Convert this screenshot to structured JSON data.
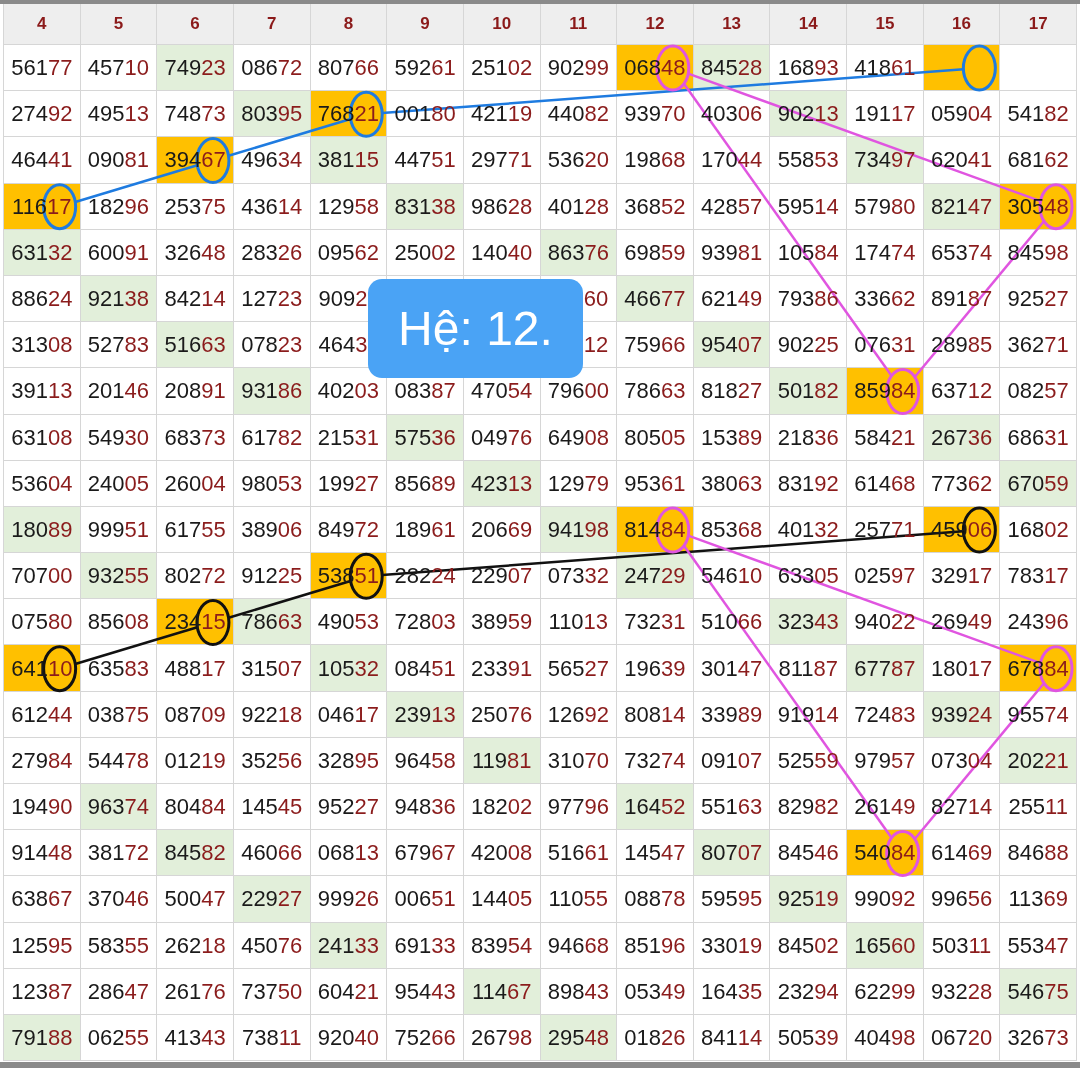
{
  "columns": [
    "4",
    "5",
    "6",
    "7",
    "8",
    "9",
    "10",
    "11",
    "12",
    "13",
    "14",
    "15",
    "16",
    "17"
  ],
  "rows": [
    {
      "cells": [
        {
          "text": "56177"
        },
        {
          "text": "45710"
        },
        {
          "text": "74923",
          "color": "#e2efda"
        },
        {
          "text": "08672"
        },
        {
          "text": "80766"
        },
        {
          "text": "59261"
        },
        {
          "text": "25102"
        },
        {
          "text": "90299"
        },
        {
          "text": "06848",
          "color": "#ffc000"
        },
        {
          "text": "84528",
          "color": "#e2efda"
        },
        {
          "text": "16893"
        },
        {
          "text": "41861"
        },
        {
          "color": "#ffc000"
        },
        {
          "kind": "empty"
        }
      ]
    },
    {
      "cells": [
        {
          "text": "27492"
        },
        {
          "text": "49513"
        },
        {
          "text": "74873"
        },
        {
          "text": "80395",
          "color": "#e2efda"
        },
        {
          "text": "76821",
          "color": "#ffc000"
        },
        {
          "text": "00180"
        },
        {
          "text": "42119"
        },
        {
          "text": "44082"
        },
        {
          "text": "93970"
        },
        {
          "text": "40306"
        },
        {
          "text": "90213",
          "color": "#e2efda"
        },
        {
          "text": "19117"
        },
        {
          "text": "05904"
        },
        {
          "text": "54182"
        }
      ]
    },
    {
      "cells": [
        {
          "text": "46441"
        },
        {
          "text": "09081"
        },
        {
          "text": "39467",
          "color": "#ffc000"
        },
        {
          "text": "49634"
        },
        {
          "text": "38115",
          "color": "#e2efda"
        },
        {
          "text": "44751"
        },
        {
          "text": "29771"
        },
        {
          "text": "53620"
        },
        {
          "text": "19868"
        },
        {
          "text": "17044"
        },
        {
          "text": "55853"
        },
        {
          "text": "73497",
          "color": "#e2efda"
        },
        {
          "text": "62041"
        },
        {
          "text": "68162"
        }
      ]
    },
    {
      "cells": [
        {
          "text": "11617",
          "color": "#ffc000"
        },
        {
          "text": "18296"
        },
        {
          "text": "25375"
        },
        {
          "text": "43614"
        },
        {
          "text": "12958"
        },
        {
          "text": "83138",
          "color": "#e2efda"
        },
        {
          "text": "98628"
        },
        {
          "text": "40128"
        },
        {
          "text": "36852"
        },
        {
          "text": "42857"
        },
        {
          "text": "59514"
        },
        {
          "text": "57980"
        },
        {
          "text": "82147",
          "color": "#e2efda"
        },
        {
          "text": "30548",
          "color": "#ffc000"
        }
      ]
    },
    {
      "cells": [
        {
          "text": "63132",
          "color": "#e2efda"
        },
        {
          "text": "60091"
        },
        {
          "text": "32648"
        },
        {
          "text": "28326"
        },
        {
          "text": "09562"
        },
        {
          "text": "25002"
        },
        {
          "text": "14040"
        },
        {
          "text": "86376",
          "color": "#e2efda"
        },
        {
          "text": "69859"
        },
        {
          "text": "93981"
        },
        {
          "text": "10584"
        },
        {
          "text": "17474"
        },
        {
          "text": "65374"
        },
        {
          "text": "84598"
        }
      ]
    },
    {
      "cells": [
        {
          "text": "88624"
        },
        {
          "text": "92138",
          "color": "#e2efda"
        },
        {
          "text": "84214"
        },
        {
          "text": "12723"
        },
        {
          "text": "9092",
          "kind": "covered-end"
        },
        {},
        {},
        {
          "text": "60",
          "kind": "covered-start"
        },
        {
          "text": "46677",
          "color": "#e2efda"
        },
        {
          "text": "62149"
        },
        {
          "text": "79386"
        },
        {
          "text": "33662"
        },
        {
          "text": "89187"
        },
        {
          "text": "92527"
        }
      ]
    },
    {
      "cells": [
        {
          "text": "31308"
        },
        {
          "text": "52783"
        },
        {
          "text": "51663",
          "color": "#e2efda"
        },
        {
          "text": "07823"
        },
        {
          "text": "4643",
          "kind": "covered-end"
        },
        {},
        {},
        {
          "text": "12",
          "kind": "covered-start"
        },
        {
          "text": "75966"
        },
        {
          "text": "95407",
          "color": "#e2efda"
        },
        {
          "text": "90225"
        },
        {
          "text": "07631"
        },
        {
          "text": "28985"
        },
        {
          "text": "36271"
        }
      ]
    },
    {
      "cells": [
        {
          "text": "39113"
        },
        {
          "text": "20146"
        },
        {
          "text": "20891"
        },
        {
          "text": "93186",
          "color": "#e2efda"
        },
        {
          "text": "40203"
        },
        {
          "text": "08387"
        },
        {
          "text": "47054"
        },
        {
          "text": "79600"
        },
        {
          "text": "78663"
        },
        {
          "text": "81827"
        },
        {
          "text": "50182",
          "color": "#e2efda"
        },
        {
          "text": "85984",
          "color": "#ffc000"
        },
        {
          "text": "63712"
        },
        {
          "text": "08257"
        }
      ]
    },
    {
      "cells": [
        {
          "text": "63108"
        },
        {
          "text": "54930"
        },
        {
          "text": "68373"
        },
        {
          "text": "61782"
        },
        {
          "text": "21531"
        },
        {
          "text": "57536",
          "color": "#e2efda"
        },
        {
          "text": "04976"
        },
        {
          "text": "64908"
        },
        {
          "text": "80505"
        },
        {
          "text": "15389"
        },
        {
          "text": "21836"
        },
        {
          "text": "58421"
        },
        {
          "text": "26736",
          "color": "#e2efda"
        },
        {
          "text": "68631"
        }
      ]
    },
    {
      "cells": [
        {
          "text": "53604"
        },
        {
          "text": "24005"
        },
        {
          "text": "26004"
        },
        {
          "text": "98053"
        },
        {
          "text": "19927"
        },
        {
          "text": "85689"
        },
        {
          "text": "42313",
          "color": "#e2efda"
        },
        {
          "text": "12979"
        },
        {
          "text": "95361"
        },
        {
          "text": "38063"
        },
        {
          "text": "83192"
        },
        {
          "text": "61468"
        },
        {
          "text": "77362"
        },
        {
          "text": "67059",
          "color": "#e2efda"
        }
      ]
    },
    {
      "cells": [
        {
          "text": "18089",
          "color": "#e2efda"
        },
        {
          "text": "99951"
        },
        {
          "text": "61755"
        },
        {
          "text": "38906"
        },
        {
          "text": "84972"
        },
        {
          "text": "18961"
        },
        {
          "text": "20669"
        },
        {
          "text": "94198",
          "color": "#e2efda"
        },
        {
          "text": "81484",
          "color": "#ffc000"
        },
        {
          "text": "85368"
        },
        {
          "text": "40132"
        },
        {
          "text": "25771"
        },
        {
          "text": "45906",
          "color": "#ffc000"
        },
        {
          "text": "16802"
        }
      ]
    },
    {
      "cells": [
        {
          "text": "70700"
        },
        {
          "text": "93255",
          "color": "#e2efda"
        },
        {
          "text": "80272"
        },
        {
          "text": "91225"
        },
        {
          "text": "53851",
          "color": "#ffc000"
        },
        {
          "text": "28224"
        },
        {
          "text": "22907"
        },
        {
          "text": "07332"
        },
        {
          "text": "24729",
          "color": "#e2efda"
        },
        {
          "text": "54610"
        },
        {
          "text": "63305"
        },
        {
          "text": "02597"
        },
        {
          "text": "32917"
        },
        {
          "text": "78317"
        }
      ]
    },
    {
      "cells": [
        {
          "text": "07580"
        },
        {
          "text": "85608"
        },
        {
          "text": "23415",
          "color": "#ffc000"
        },
        {
          "text": "78663",
          "color": "#e2efda"
        },
        {
          "text": "49053"
        },
        {
          "text": "72803"
        },
        {
          "text": "38959"
        },
        {
          "text": "11013"
        },
        {
          "text": "73231"
        },
        {
          "text": "51066"
        },
        {
          "text": "32343",
          "color": "#e2efda"
        },
        {
          "text": "94022"
        },
        {
          "text": "26949"
        },
        {
          "text": "24396"
        }
      ]
    },
    {
      "cells": [
        {
          "text": "64110",
          "color": "#ffc000"
        },
        {
          "text": "63583"
        },
        {
          "text": "48817"
        },
        {
          "text": "31507"
        },
        {
          "text": "10532",
          "color": "#e2efda"
        },
        {
          "text": "08451"
        },
        {
          "text": "23391"
        },
        {
          "text": "56527"
        },
        {
          "text": "19639"
        },
        {
          "text": "30147"
        },
        {
          "text": "81187"
        },
        {
          "text": "67787",
          "color": "#e2efda"
        },
        {
          "text": "18017"
        },
        {
          "text": "67884",
          "color": "#ffc000"
        }
      ]
    },
    {
      "cells": [
        {
          "text": "61244"
        },
        {
          "text": "03875"
        },
        {
          "text": "08709"
        },
        {
          "text": "92218"
        },
        {
          "text": "04617"
        },
        {
          "text": "23913",
          "color": "#e2efda"
        },
        {
          "text": "25076"
        },
        {
          "text": "12692"
        },
        {
          "text": "80814"
        },
        {
          "text": "33989"
        },
        {
          "text": "91914"
        },
        {
          "text": "72483"
        },
        {
          "text": "93924",
          "color": "#e2efda"
        },
        {
          "text": "95574"
        }
      ]
    },
    {
      "cells": [
        {
          "text": "27984"
        },
        {
          "text": "54478"
        },
        {
          "text": "01219"
        },
        {
          "text": "35256"
        },
        {
          "text": "32895"
        },
        {
          "text": "96458"
        },
        {
          "text": "11981",
          "color": "#e2efda"
        },
        {
          "text": "31070"
        },
        {
          "text": "73274"
        },
        {
          "text": "09107"
        },
        {
          "text": "52559"
        },
        {
          "text": "97957"
        },
        {
          "text": "07304"
        },
        {
          "text": "20221",
          "color": "#e2efda"
        }
      ]
    },
    {
      "cells": [
        {
          "text": "19490"
        },
        {
          "text": "96374",
          "color": "#e2efda"
        },
        {
          "text": "80484"
        },
        {
          "text": "14545"
        },
        {
          "text": "95227"
        },
        {
          "text": "94836"
        },
        {
          "text": "18202"
        },
        {
          "text": "97796"
        },
        {
          "text": "16452",
          "color": "#e2efda"
        },
        {
          "text": "55163"
        },
        {
          "text": "82982"
        },
        {
          "text": "26149"
        },
        {
          "text": "82714"
        },
        {
          "text": "25511"
        }
      ]
    },
    {
      "cells": [
        {
          "text": "91448"
        },
        {
          "text": "38172"
        },
        {
          "text": "84582",
          "color": "#e2efda"
        },
        {
          "text": "46066"
        },
        {
          "text": "06813"
        },
        {
          "text": "67967"
        },
        {
          "text": "42008"
        },
        {
          "text": "51661"
        },
        {
          "text": "14547"
        },
        {
          "text": "80707",
          "color": "#e2efda"
        },
        {
          "text": "84546"
        },
        {
          "text": "54084",
          "color": "#ffc000"
        },
        {
          "text": "61469"
        },
        {
          "text": "84688"
        }
      ]
    },
    {
      "cells": [
        {
          "text": "63867"
        },
        {
          "text": "37046"
        },
        {
          "text": "50047"
        },
        {
          "text": "22927",
          "color": "#e2efda"
        },
        {
          "text": "99926"
        },
        {
          "text": "00651"
        },
        {
          "text": "14405"
        },
        {
          "text": "11055"
        },
        {
          "text": "08878"
        },
        {
          "text": "59595"
        },
        {
          "text": "92519",
          "color": "#e2efda"
        },
        {
          "text": "99092"
        },
        {
          "text": "99656"
        },
        {
          "text": "11369"
        }
      ]
    },
    {
      "cells": [
        {
          "text": "12595"
        },
        {
          "text": "58355"
        },
        {
          "text": "26218"
        },
        {
          "text": "45076"
        },
        {
          "text": "24133",
          "color": "#e2efda"
        },
        {
          "text": "69133"
        },
        {
          "text": "83954"
        },
        {
          "text": "94668"
        },
        {
          "text": "85196"
        },
        {
          "text": "33019"
        },
        {
          "text": "84502"
        },
        {
          "text": "16560",
          "color": "#e2efda"
        },
        {
          "text": "50311"
        },
        {
          "text": "55347"
        }
      ]
    },
    {
      "cells": [
        {
          "text": "12387"
        },
        {
          "text": "28647"
        },
        {
          "text": "26176"
        },
        {
          "text": "73750"
        },
        {
          "text": "60421"
        },
        {
          "text": "95443"
        },
        {
          "text": "11467",
          "color": "#e2efda"
        },
        {
          "text": "89843"
        },
        {
          "text": "05349"
        },
        {
          "text": "16435"
        },
        {
          "text": "23294"
        },
        {
          "text": "62299"
        },
        {
          "text": "93228"
        },
        {
          "text": "54675",
          "color": "#e2efda"
        }
      ]
    },
    {
      "cells": [
        {
          "text": "79188",
          "color": "#e2efda"
        },
        {
          "text": "06255"
        },
        {
          "text": "41343"
        },
        {
          "text": "73811"
        },
        {
          "text": "92040"
        },
        {
          "text": "75266"
        },
        {
          "text": "26798"
        },
        {
          "text": "29548",
          "color": "#e2efda"
        },
        {
          "text": "01826"
        },
        {
          "text": "84114"
        },
        {
          "text": "50539"
        },
        {
          "text": "40498"
        },
        {
          "text": "06720"
        },
        {
          "text": "32673"
        }
      ]
    }
  ],
  "label": "Hệ: 12."
}
